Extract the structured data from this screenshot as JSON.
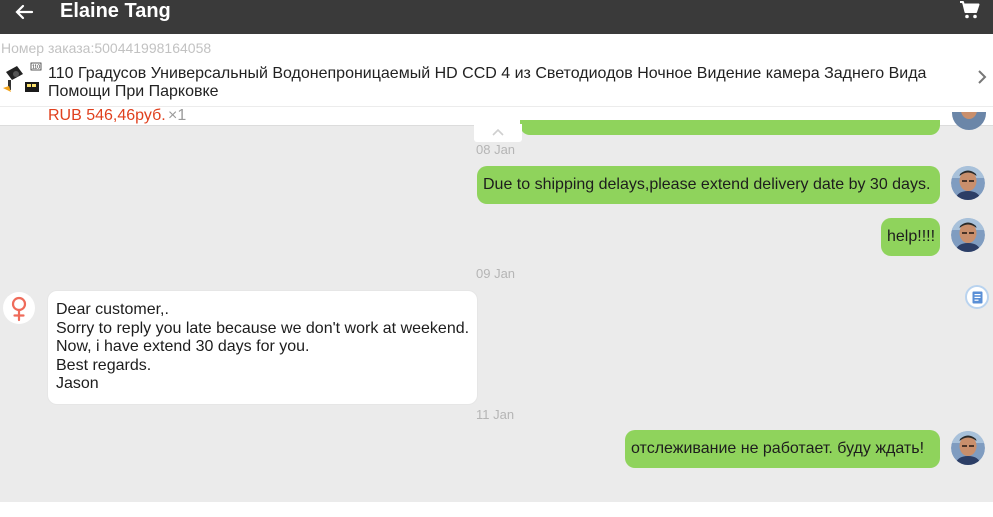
{
  "header": {
    "title": "Elaine Tang",
    "back_icon": "arrow-left-icon",
    "cart_icon": "shopping-cart-icon",
    "bar_color": "#3a3a3a"
  },
  "order": {
    "order_number": "Номер заказа:500441998164058",
    "product_title": "110 Градусов Универсальный Водонепроницаемый HD CCD 4 из Светодиодов Ночное Видение камера Заднего Вида Помощи При Парковке",
    "price": "RUB 546,46руб.",
    "quantity": "×1",
    "price_color": "#e0401e"
  },
  "messages": [
    {
      "type": "date",
      "text": "08 Jan"
    },
    {
      "type": "outgoing",
      "text": "Due to shipping delays,please extend delivery date by 30 days."
    },
    {
      "type": "outgoing",
      "text": "help!!!!"
    },
    {
      "type": "date",
      "text": "09 Jan"
    },
    {
      "type": "incoming",
      "lines": [
        "Dear customer,.",
        "Sorry to reply you late because we don't work at weekend.",
        "Now, i have extend 30 days for you.",
        "Best regards.",
        "Jason"
      ]
    },
    {
      "type": "date",
      "text": "11 Jan"
    },
    {
      "type": "outgoing",
      "text": "отслеживание не работает. буду ждать!"
    }
  ],
  "colors": {
    "outgoing_bubble": "#8fd35c",
    "incoming_bubble": "#ffffff",
    "chat_background": "#ebebeb"
  }
}
